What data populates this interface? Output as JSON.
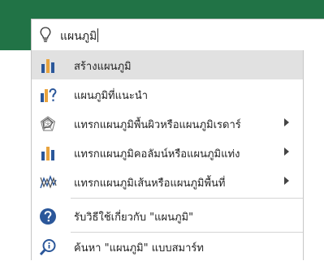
{
  "search": {
    "query": "แผนภูมิ"
  },
  "menu": {
    "items": [
      {
        "label": "สร้างแผนภูมิ",
        "icon": "bar-chart-icon",
        "submenu": false
      },
      {
        "label": "แผนภูมิที่แนะนำ",
        "icon": "recommended-chart-icon",
        "submenu": false
      },
      {
        "label": "แทรกแผนภูมิพื้นผิวหรือแผนภูมิเรดาร์",
        "icon": "radar-chart-icon",
        "submenu": true
      },
      {
        "label": "แทรกแผนภูมิคอลัมน์หรือแผนภูมิแท่ง",
        "icon": "column-chart-icon",
        "submenu": true
      },
      {
        "label": "แทรกแผนภูมิเส้นหรือแผนภูมิพื้นที่",
        "icon": "line-area-chart-icon",
        "submenu": true
      },
      {
        "label": "รับวิธีใช้เกี่ยวกับ \"แผนภูมิ\"",
        "icon": "help-icon",
        "submenu": false
      },
      {
        "label": "ค้นหา \"แผนภูมิ\" แบบสมาร์ท",
        "icon": "smart-lookup-icon",
        "submenu": false
      }
    ]
  },
  "colors": {
    "ribbon": "#217346",
    "highlight": "#e1e1e1",
    "accent_blue": "#2b579a",
    "accent_orange": "#e8a33d"
  }
}
